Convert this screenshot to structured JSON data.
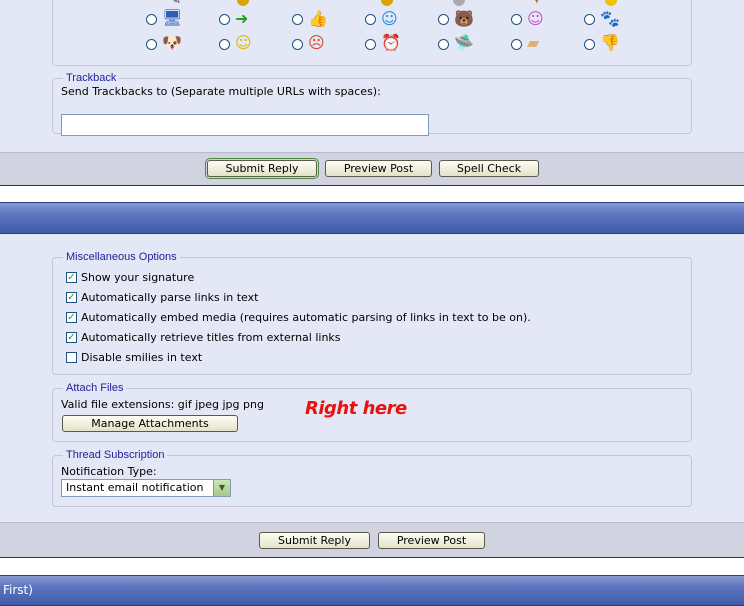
{
  "smilies_row1_icons": [
    "computer-smilie",
    "arrow-smilie",
    "thumbsup-smilie",
    "cool-smilie",
    "bear-smilie",
    "purple-smilie",
    "paw-smilie"
  ],
  "smilies_row2_icons": [
    "dog-smilie",
    "happy-smilie",
    "angry-smilie",
    "clock-smilie",
    "ufo-smilie",
    "tissue-smilie",
    "thumbsdown-smilie"
  ],
  "trackback": {
    "legend": "Trackback",
    "label": "Send Trackbacks to (Separate multiple URLs with spaces):",
    "value": ""
  },
  "buttons_top": {
    "submit": "Submit Reply",
    "preview": "Preview Post",
    "spell": "Spell Check"
  },
  "misc": {
    "legend": "Miscellaneous Options",
    "options": [
      {
        "label": "Show your signature",
        "checked": true
      },
      {
        "label": "Automatically parse links in text",
        "checked": true
      },
      {
        "label": "Automatically embed media (requires automatic parsing of links in text to be on).",
        "checked": true
      },
      {
        "label": "Automatically retrieve titles from external links",
        "checked": true
      },
      {
        "label": "Disable smilies in text",
        "checked": false
      }
    ]
  },
  "attach": {
    "legend": "Attach Files",
    "extensions_label": "Valid file extensions: gif jpeg jpg png",
    "button": "Manage Attachments",
    "annotation": "Right here"
  },
  "subscription": {
    "legend": "Thread Subscription",
    "label": "Notification Type:",
    "selected": "Instant email notification"
  },
  "buttons_bottom": {
    "submit": "Submit Reply",
    "preview": "Preview Post"
  },
  "footer_band": {
    "text": "First)"
  },
  "colors": {
    "panel": "#e4e7f5",
    "legend": "#22229c",
    "header_band": "#3f5ba8",
    "annotation": "#e8120f"
  }
}
